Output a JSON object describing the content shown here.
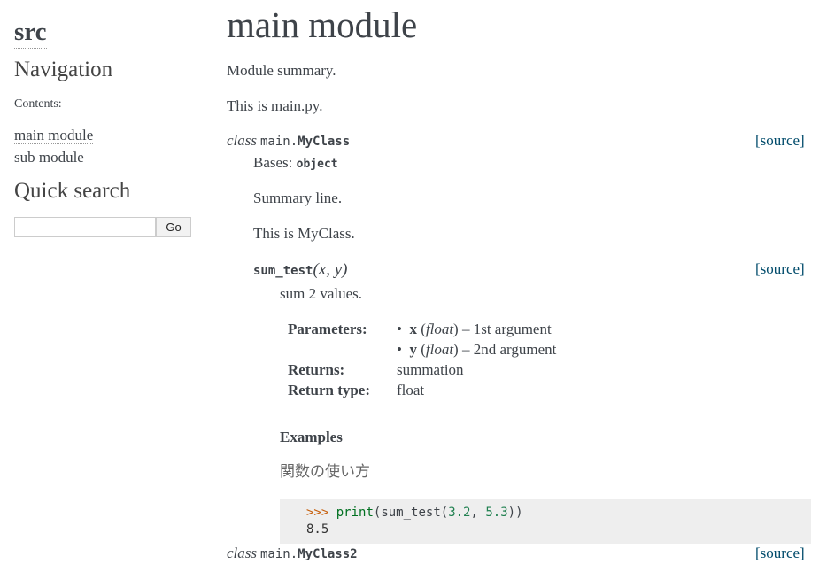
{
  "sidebar": {
    "logo": "src",
    "navigation_title": "Navigation",
    "contents_label": "Contents:",
    "toc": [
      "main module",
      "sub module"
    ],
    "quick_search_title": "Quick search",
    "search_value": "",
    "go_label": "Go"
  },
  "main": {
    "title": "main module",
    "summary": "Module summary.",
    "desc": "This is main.py.",
    "source_label": "[source]",
    "class1": {
      "keyword": "class",
      "prefix": "main.",
      "name": "MyClass",
      "bases_label": "Bases:",
      "bases_value": "object",
      "summary": "Summary line.",
      "desc": "This is MyClass."
    },
    "method": {
      "name": "sum_test",
      "params": "(x, y)",
      "desc": "sum 2 values.",
      "parameters_label": "Parameters:",
      "params_list": [
        {
          "name": "x",
          "type": "float",
          "desc": " – 1st argument"
        },
        {
          "name": "y",
          "type": "float",
          "desc": " – 2nd argument"
        }
      ],
      "returns_label": "Returns:",
      "returns_value": "summation",
      "return_type_label": "Return type:",
      "return_type_value": "float",
      "examples_label": "Examples",
      "examples_desc": "関数の使い方",
      "code": {
        "prompt": ">>>",
        "builtin": "print",
        "open": "(sum_test(",
        "arg1": "3.2",
        "sep": ", ",
        "arg2": "5.3",
        "close": "))",
        "output": "8.5"
      }
    },
    "class2": {
      "keyword": "class",
      "prefix": "main.",
      "name": "MyClass2"
    }
  }
}
